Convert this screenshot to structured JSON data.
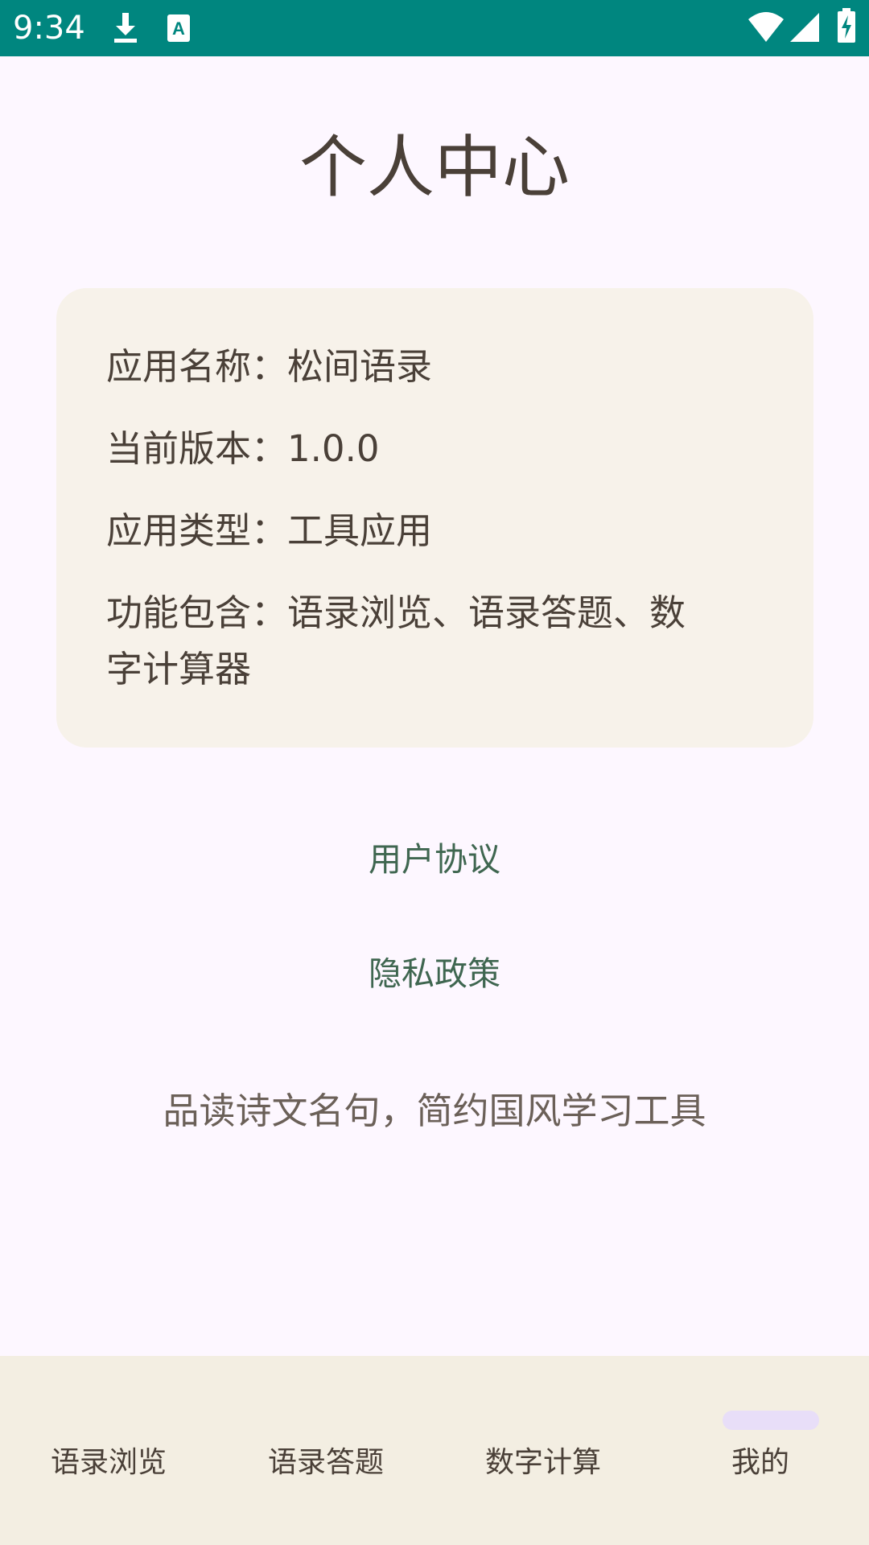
{
  "status_bar": {
    "time": "9:34",
    "icons": [
      "download-icon",
      "a-box-icon",
      "wifi-icon",
      "signal-icon",
      "battery-charging-icon"
    ]
  },
  "page": {
    "title": "个人中心"
  },
  "info_card": {
    "app_name": "应用名称：松间语录",
    "version": "当前版本：1.0.0",
    "app_type": "应用类型：工具应用",
    "features_line1": "功能包含：语录浏览、语录答题、数",
    "features_line2": "字计算器"
  },
  "links": {
    "user_agreement": "用户协议",
    "privacy_policy": "隐私政策"
  },
  "slogan": "品读诗文名句，简约国风学习工具",
  "bottom_nav": {
    "items": [
      {
        "label": "语录浏览",
        "selected": false
      },
      {
        "label": "语录答题",
        "selected": false
      },
      {
        "label": "数字计算",
        "selected": false
      },
      {
        "label": "我的",
        "selected": true
      }
    ]
  },
  "colors": {
    "status_bar": "#00867F",
    "background": "#FDF7FF",
    "card": "#F7F2EA",
    "link": "#3F6650",
    "nav_background": "#F3EEE2",
    "nav_indicator": "#E8DEF8"
  }
}
